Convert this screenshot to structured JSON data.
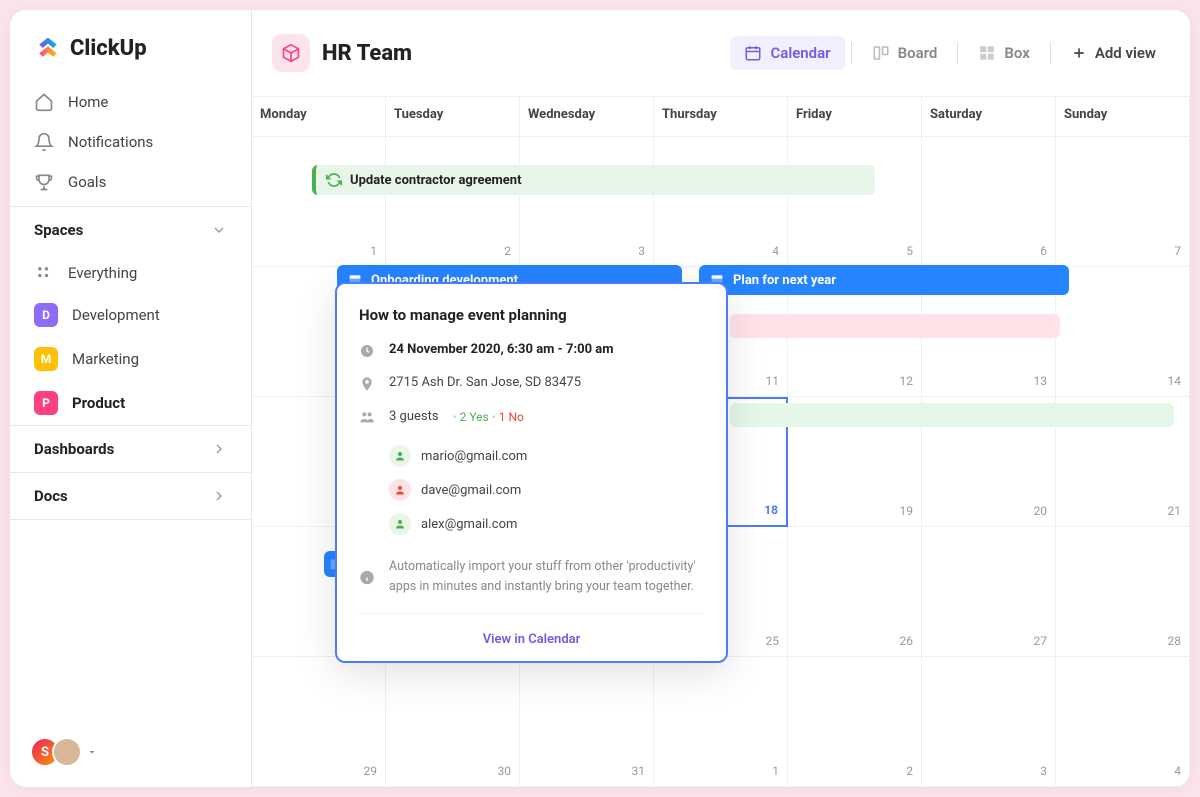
{
  "brand": "ClickUp",
  "nav": {
    "home": "Home",
    "notifications": "Notifications",
    "goals": "Goals"
  },
  "spaces_header": "Spaces",
  "spaces": {
    "everything": "Everything",
    "items": [
      {
        "letter": "D",
        "label": "Development",
        "color": "#8e6cf7"
      },
      {
        "letter": "M",
        "label": "Marketing",
        "color": "#ffc107"
      },
      {
        "letter": "P",
        "label": "Product",
        "color": "#ff4081"
      }
    ]
  },
  "dashboards": "Dashboards",
  "docs": "Docs",
  "workspace": {
    "title": "HR Team"
  },
  "views": {
    "calendar": "Calendar",
    "board": "Board",
    "box": "Box",
    "add": "Add view"
  },
  "days": [
    "Monday",
    "Tuesday",
    "Wednesday",
    "Thursday",
    "Friday",
    "Saturday",
    "Sunday"
  ],
  "dates": [
    [
      "",
      "",
      "",
      "",
      "",
      "",
      ""
    ],
    [
      "1",
      "2",
      "3",
      "4",
      "5",
      "6",
      "7"
    ],
    [
      "",
      "",
      "",
      "11",
      "12",
      "13",
      "14"
    ],
    [
      "",
      "",
      "",
      "18",
      "19",
      "20",
      "21"
    ],
    [
      "",
      "",
      "",
      "25",
      "26",
      "27",
      "28"
    ],
    [
      "29",
      "30",
      "31",
      "1",
      "2",
      "3",
      "4"
    ]
  ],
  "events": {
    "contractor": "Update contractor agreement",
    "onboarding": "Onboarding development",
    "plan": "Plan for next year"
  },
  "popover": {
    "title": "How to manage event planning",
    "datetime": "24 November 2020, 6:30 am - 7:00 am",
    "location": "2715 Ash Dr. San Jose, SD 83475",
    "guests_label": "3 guests",
    "yes": "2 Yes",
    "no": "1 No",
    "guests": [
      "mario@gmail.com",
      "dave@gmail.com",
      "alex@gmail.com"
    ],
    "desc": "Automatically import your stuff from other 'productivity' apps in minutes and instantly bring your team together.",
    "cta": "View in Calendar"
  },
  "user_initial": "S"
}
